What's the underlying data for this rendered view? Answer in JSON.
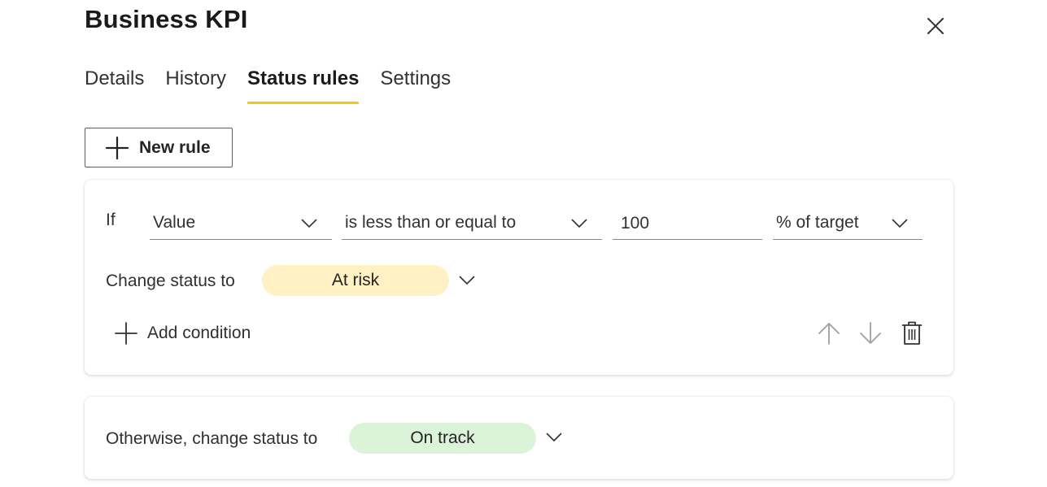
{
  "dialog": {
    "title": "Business KPI"
  },
  "tabs": [
    {
      "label": "Details",
      "active": false
    },
    {
      "label": "History",
      "active": false
    },
    {
      "label": "Status rules",
      "active": true
    },
    {
      "label": "Settings",
      "active": false
    }
  ],
  "toolbar": {
    "new_rule_label": "New rule"
  },
  "rule": {
    "if_label": "If",
    "field": "Value",
    "operator": "is less than or equal to",
    "value": "100",
    "unit": "% of target",
    "change_status_label": "Change status to",
    "status": "At risk",
    "add_condition_label": "Add condition"
  },
  "otherwise": {
    "label": "Otherwise, change status to",
    "status": "On track"
  },
  "colors": {
    "accent": "#f2c811",
    "at_risk_bg": "#fff1c4",
    "on_track_bg": "#dbf3d9"
  },
  "icons": {
    "close": "close-icon",
    "plus": "plus-icon",
    "chevron": "chevron-down-icon",
    "move_up": "arrow-up-icon",
    "move_down": "arrow-down-icon",
    "delete": "trash-icon"
  }
}
